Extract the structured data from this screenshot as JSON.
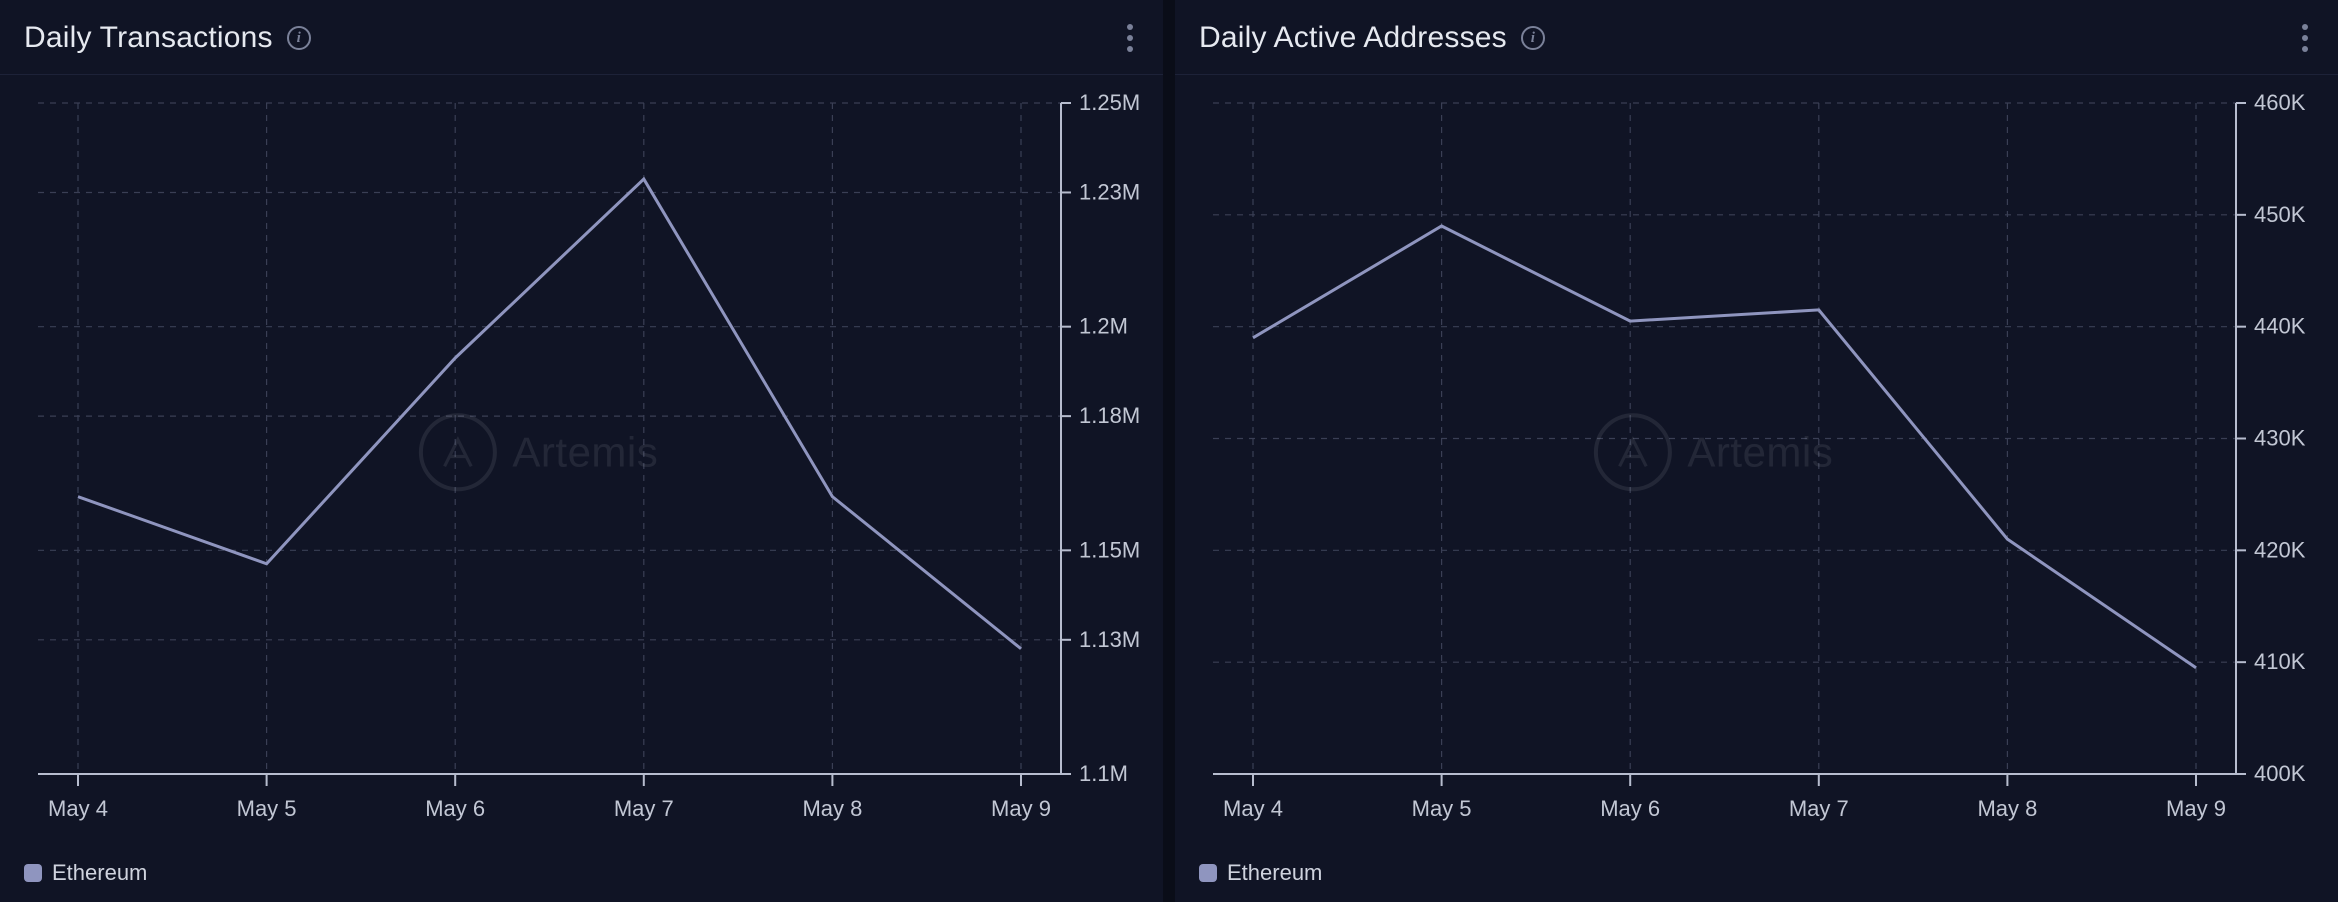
{
  "watermark": "Artemis",
  "panels": [
    {
      "title": "Daily Transactions",
      "legend": "Ethereum"
    },
    {
      "title": "Daily Active Addresses",
      "legend": "Ethereum"
    }
  ],
  "chart_data": [
    {
      "type": "line",
      "title": "Daily Transactions",
      "xlabel": "",
      "ylabel": "",
      "categories": [
        "May 4",
        "May 5",
        "May 6",
        "May 7",
        "May 8",
        "May 9"
      ],
      "series": [
        {
          "name": "Ethereum",
          "values": [
            1162000,
            1147000,
            1193000,
            1233000,
            1162000,
            1128000
          ]
        }
      ],
      "ylim": [
        1100000,
        1250000
      ],
      "yticks": [
        1100000,
        1130000,
        1150000,
        1180000,
        1200000,
        1230000,
        1250000
      ],
      "ytick_labels": [
        "1.1M",
        "1.13M",
        "1.15M",
        "1.18M",
        "1.2M",
        "1.23M",
        "1.25M"
      ]
    },
    {
      "type": "line",
      "title": "Daily Active Addresses",
      "xlabel": "",
      "ylabel": "",
      "categories": [
        "May 4",
        "May 5",
        "May 6",
        "May 7",
        "May 8",
        "May 9"
      ],
      "series": [
        {
          "name": "Ethereum",
          "values": [
            439000,
            449000,
            440500,
            441500,
            421000,
            409500
          ]
        }
      ],
      "ylim": [
        400000,
        460000
      ],
      "yticks": [
        400000,
        410000,
        420000,
        430000,
        440000,
        450000,
        460000
      ],
      "ytick_labels": [
        "400K",
        "410K",
        "420K",
        "430K",
        "440K",
        "450K",
        "460K"
      ]
    }
  ]
}
